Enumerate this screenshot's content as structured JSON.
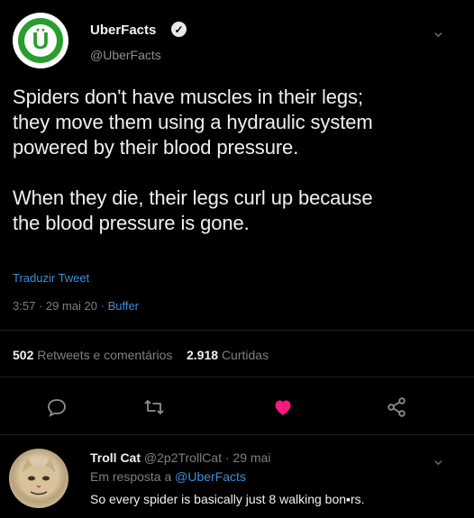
{
  "tweet": {
    "author_name": "UberFacts",
    "author_handle": "@UberFacts",
    "avatar_letter": "Ü",
    "text": "Spiders don't have muscles in their legs;\nthey move them using a hydraulic system\npowered by their blood pressure.\n\nWhen they die, their legs curl up because\nthe blood pressure is gone.",
    "translate_label": "Traduzir Tweet",
    "time": "3:57",
    "date": "29 mai 20",
    "source": "Buffer",
    "retweets_count": "502",
    "retweets_label": "Retweets e comentários",
    "likes_count": "2.918",
    "likes_label": "Curtidas"
  },
  "actions": [
    {
      "icon": "reply-icon"
    },
    {
      "icon": "retweet-icon"
    },
    {
      "icon": "like-icon",
      "color": "#f91880"
    },
    {
      "icon": "share-icon"
    }
  ],
  "reply": {
    "author_name": "Troll Cat",
    "author_handle": "@2p2TrollCat",
    "date": "29 mai",
    "replying_to_label": "Em resposta a",
    "replying_to_handle": "@UberFacts",
    "text": "So every spider is basically just 8 walking bon▪rs."
  },
  "colors": {
    "background": "#000000",
    "link": "#3b8fd6",
    "like": "#f91880",
    "avatar_green": "#2a9d2f"
  }
}
